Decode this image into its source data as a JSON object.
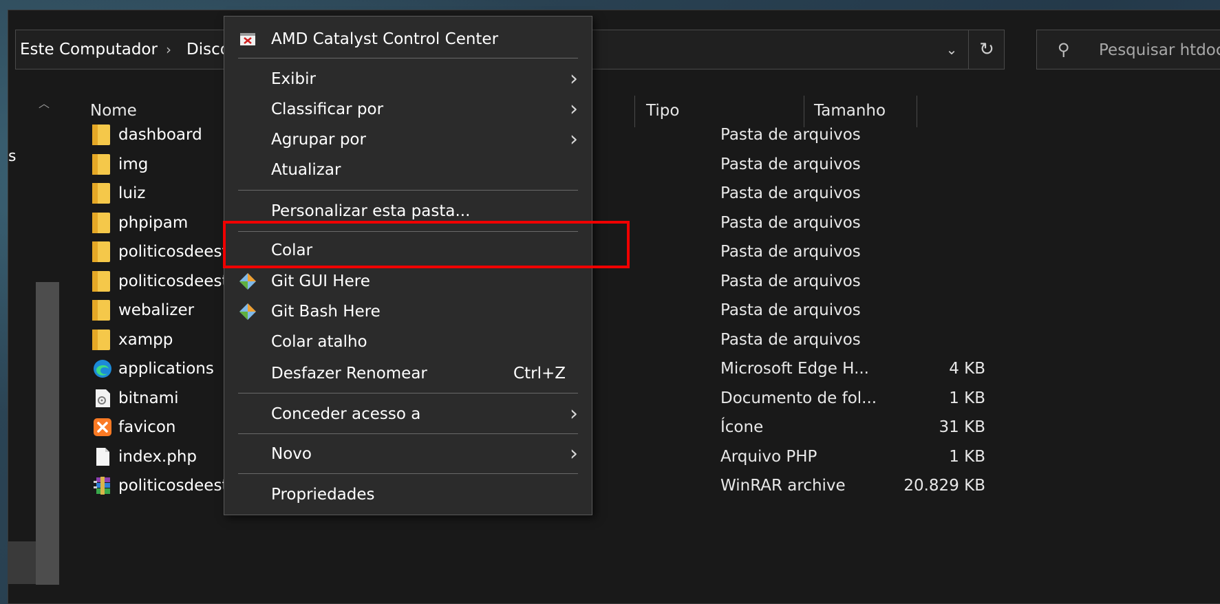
{
  "breadcrumb": {
    "root": "Este Computador",
    "disk": "Disco"
  },
  "search": {
    "placeholder": "Pesquisar htdocs"
  },
  "nav": {
    "label_fragment": "s"
  },
  "columns": {
    "name": "Nome",
    "type": "Tipo",
    "size": "Tamanho"
  },
  "files": [
    {
      "name": "dashboard",
      "type": "Pasta de arquivos",
      "size": "",
      "icon": "folder-icon"
    },
    {
      "name": "img",
      "type": "Pasta de arquivos",
      "size": "",
      "icon": "folder-icon"
    },
    {
      "name": "luiz",
      "type": "Pasta de arquivos",
      "size": "",
      "icon": "folder-icon"
    },
    {
      "name": "phpipam",
      "type": "Pasta de arquivos",
      "size": "",
      "icon": "folder-icon"
    },
    {
      "name": "politicosdeestir",
      "type": "Pasta de arquivos",
      "size": "",
      "icon": "folder-icon"
    },
    {
      "name": "politicosdeestir",
      "type": "Pasta de arquivos",
      "size": "",
      "icon": "folder-icon"
    },
    {
      "name": "webalizer",
      "type": "Pasta de arquivos",
      "size": "",
      "icon": "folder-icon"
    },
    {
      "name": "xampp",
      "type": "Pasta de arquivos",
      "size": "",
      "icon": "folder-icon"
    },
    {
      "name": "applications",
      "type": "Microsoft Edge H...",
      "size": "4 KB",
      "icon": "edge-icon"
    },
    {
      "name": "bitnami",
      "type": "Documento de fol...",
      "size": "1 KB",
      "icon": "stylesheet-icon"
    },
    {
      "name": "favicon",
      "type": "Ícone",
      "size": "31 KB",
      "icon": "xampp-icon"
    },
    {
      "name": "index.php",
      "type": "Arquivo PHP",
      "size": "1 KB",
      "icon": "file-icon"
    },
    {
      "name": "politicosdeestir",
      "type": "WinRAR archive",
      "size": "20.829 KB",
      "icon": "winrar-icon"
    }
  ],
  "context_menu": {
    "amd": "AMD Catalyst Control Center",
    "exibir": "Exibir",
    "classificar": "Classificar por",
    "agrupar": "Agrupar por",
    "atualizar": "Atualizar",
    "personalizar": "Personalizar esta pasta...",
    "colar": "Colar",
    "git_gui": "Git GUI Here",
    "git_bash": "Git Bash Here",
    "colar_atalho": "Colar atalho",
    "desfazer": "Desfazer Renomear",
    "desfazer_shortcut": "Ctrl+Z",
    "conceder": "Conceder acesso a",
    "novo": "Novo",
    "propriedades": "Propriedades"
  },
  "colors": {
    "highlight": "#f00000",
    "menu_bg": "#2b2b2b",
    "window_bg": "#191919"
  }
}
